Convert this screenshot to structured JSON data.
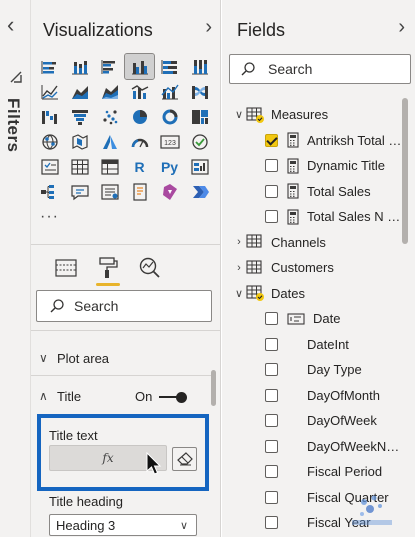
{
  "filters": {
    "label": "Filters",
    "collapse_icon": "chevron-left-icon",
    "filter_icon": "filter-icon"
  },
  "visualizations": {
    "title": "Visualizations",
    "expand_icon": "chevron-right-icon",
    "selected_index": 3,
    "more": "···",
    "visual_icons": [
      "stacked-bar-chart",
      "stacked-column-chart",
      "clustered-bar-chart",
      "clustered-column-chart",
      "100-stacked-bar-chart",
      "100-stacked-column-chart",
      "line-chart",
      "area-chart",
      "stacked-area-chart",
      "line-and-stacked-column-chart",
      "line-and-clustered-column-chart",
      "ribbon-chart",
      "waterfall-chart",
      "funnel-chart",
      "scatter-chart",
      "pie-chart",
      "donut-chart",
      "treemap",
      "map",
      "filled-map",
      "azure-map",
      "gauge",
      "card",
      "kpi",
      "slicer",
      "table",
      "matrix",
      "r-script-visual",
      "python-visual",
      "key-influencers",
      "decomposition-tree",
      "qa-visual",
      "smart-narrative",
      "paginated-report",
      "power-apps",
      "power-automate",
      "more-visuals"
    ],
    "r_label": "R",
    "py_label": "Py",
    "card_label": "123",
    "format_tabs": [
      "fields-tab",
      "format-tab",
      "analytics-tab"
    ],
    "active_format_tab": 1,
    "search_placeholder": "Search",
    "sections": {
      "plot_area": "Plot area",
      "title": "Title",
      "title_toggle": "On",
      "title_text_label": "Title text",
      "fx_label": "fx",
      "title_heading_label": "Title heading",
      "heading_value": "Heading 3"
    }
  },
  "fields": {
    "title": "Fields",
    "expand_icon": "chevron-right-icon",
    "search_placeholder": "Search",
    "tables": [
      {
        "name": "Measures",
        "expanded": true,
        "items": [
          {
            "name": "Antriksh Total S...",
            "checked": true
          },
          {
            "name": "Dynamic Title",
            "checked": false
          },
          {
            "name": "Total Sales",
            "checked": false
          },
          {
            "name": "Total Sales N B...",
            "checked": false
          }
        ]
      },
      {
        "name": "Channels",
        "expanded": false,
        "items": []
      },
      {
        "name": "Customers",
        "expanded": false,
        "items": []
      },
      {
        "name": "Dates",
        "expanded": true,
        "items": [
          {
            "name": "Date",
            "checked": false
          },
          {
            "name": "DateInt",
            "checked": false
          },
          {
            "name": "Day Type",
            "checked": false
          },
          {
            "name": "DayOfMonth",
            "checked": false
          },
          {
            "name": "DayOfWeek",
            "checked": false
          },
          {
            "name": "DayOfWeekNa...",
            "checked": false
          },
          {
            "name": "Fiscal Period",
            "checked": false
          },
          {
            "name": "Fiscal Quarter",
            "checked": false
          },
          {
            "name": "Fiscal Year",
            "checked": false
          }
        ]
      }
    ]
  },
  "colors": {
    "accent_yellow": "#f2c811",
    "highlight_blue": "#1565c0",
    "icon_blue": "#1f6fb7",
    "icon_dark": "#3b3a39"
  }
}
